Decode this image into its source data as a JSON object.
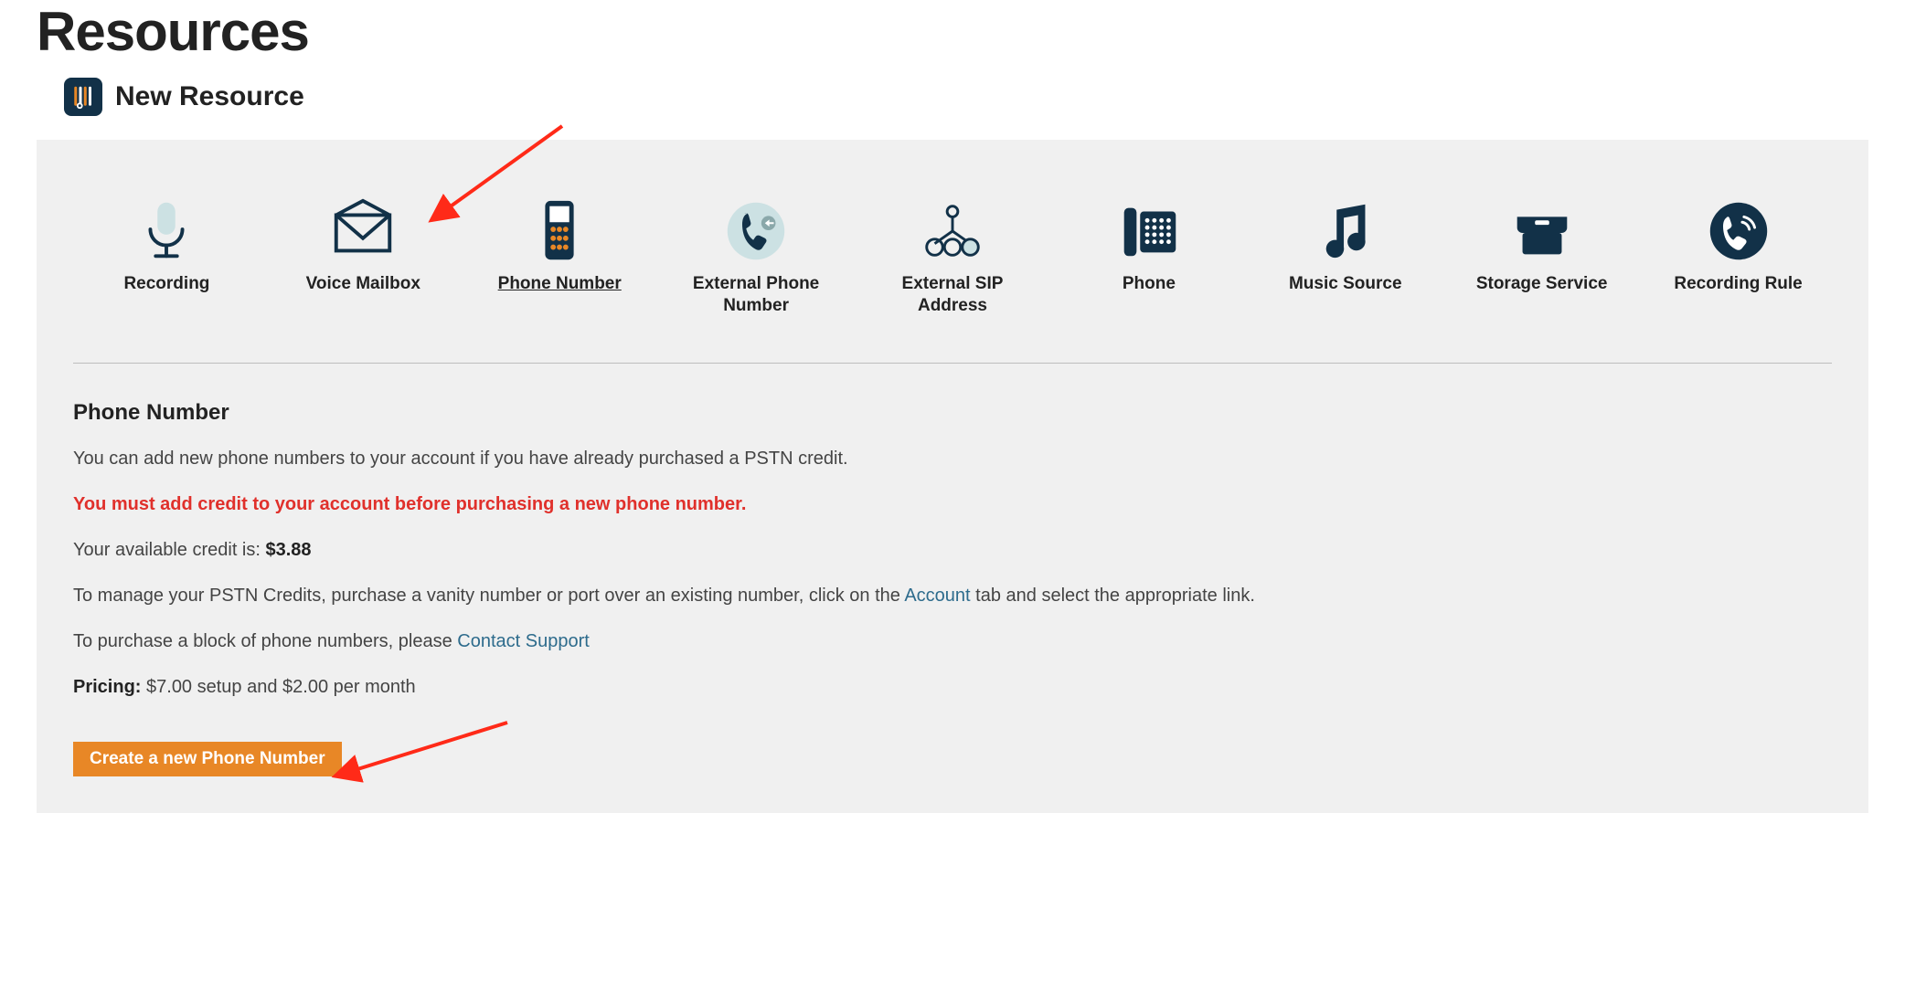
{
  "page": {
    "title": "Resources",
    "subtitle": "New Resource"
  },
  "resources": [
    {
      "id": "recording",
      "label": "Recording"
    },
    {
      "id": "voice-mailbox",
      "label": "Voice Mailbox"
    },
    {
      "id": "phone-number",
      "label": "Phone Number",
      "active": true
    },
    {
      "id": "external-phone",
      "label": "External Phone Number"
    },
    {
      "id": "external-sip",
      "label": "External SIP Address"
    },
    {
      "id": "phone",
      "label": "Phone"
    },
    {
      "id": "music-source",
      "label": "Music Source"
    },
    {
      "id": "storage-service",
      "label": "Storage Service"
    },
    {
      "id": "recording-rule",
      "label": "Recording Rule"
    }
  ],
  "detail": {
    "title": "Phone Number",
    "intro": "You can add new phone numbers to your account if you have already purchased a PSTN credit.",
    "warning": "You must add credit to your account before purchasing a new phone number.",
    "credit_label": "Your available credit is: ",
    "credit_value": "$3.88",
    "manage_pre": "To manage your PSTN Credits, purchase a vanity number or port over an existing number, click on the ",
    "manage_link": "Account",
    "manage_post": " tab and select the appropriate link.",
    "block_pre": "To purchase a block of phone numbers, please ",
    "block_link": "Contact Support",
    "pricing_label": "Pricing:",
    "pricing_value": " $7.00 setup and $2.00 per month",
    "cta": "Create a new Phone Number"
  }
}
